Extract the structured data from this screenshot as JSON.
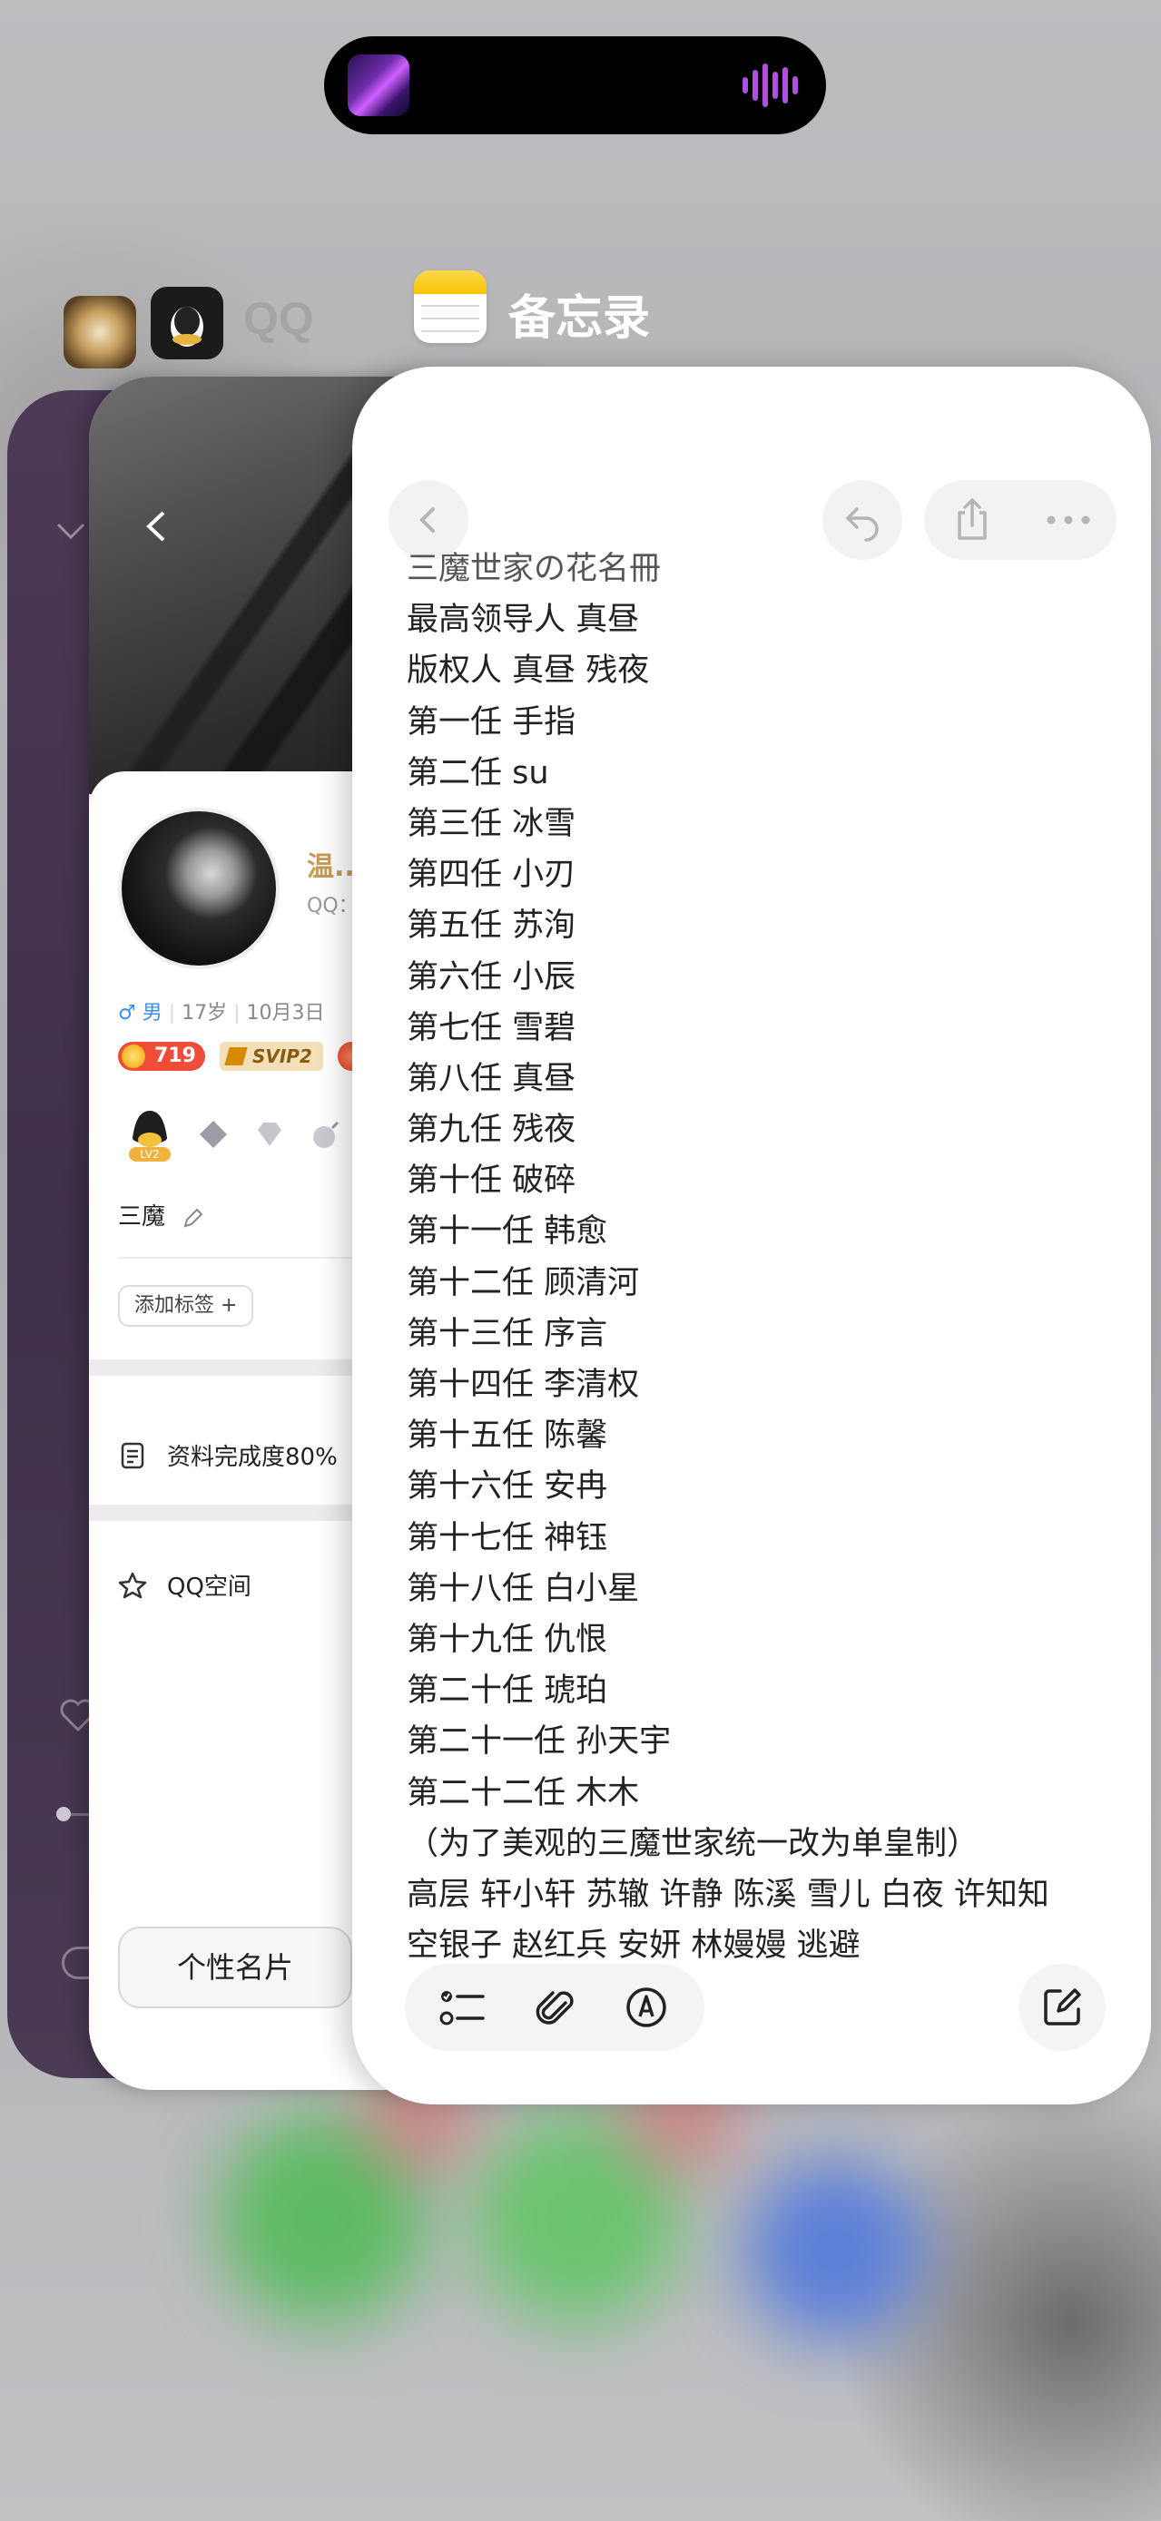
{
  "switcher": {
    "qq_app_name": "QQ",
    "notes_app_name": "备忘录"
  },
  "qq_card": {
    "name": "温...",
    "qq_number_label": "QQ：",
    "gender": "♂ 男",
    "age": "17岁",
    "birthday": "10月3日",
    "coin_count": "719",
    "svip_label": "SVIP2",
    "level_badge": "LV2",
    "motto": "三魔",
    "add_tag_label": "添加标签 +",
    "profile_completion": "资料完成度80%",
    "qzone": "QQ空间",
    "card_button": "个性名片"
  },
  "notes": {
    "lines": [
      "三魔世家の花名冊",
      "最高领导人 真昼",
      "版权人 真昼 残夜",
      "第一任 手指",
      "第二任 su",
      "第三任 冰雪",
      "第四任 小刃",
      "第五任 苏洵",
      "第六任 小辰",
      "第七任 雪碧",
      "第八任 真昼",
      "第九任 残夜",
      "第十任 破碎",
      "第十一任 韩愈",
      "第十二任 顾清河",
      "第十三任 序言",
      "第十四任 李清权",
      "第十五任 陈馨",
      "第十六任 安冉",
      "第十七任 神钰",
      "第十八任 白小星",
      "第十九任 仇恨",
      "第二十任 琥珀",
      "第二十一任 孙天宇",
      "第二十二任 木木",
      "（为了美观的三魔世家统一改为单皇制）",
      "高层 轩小轩 苏辙 许静 陈溪 雪儿 白夜 许知知",
      "空银子 赵红兵 安妍 林嫚嫚 逃避"
    ]
  }
}
